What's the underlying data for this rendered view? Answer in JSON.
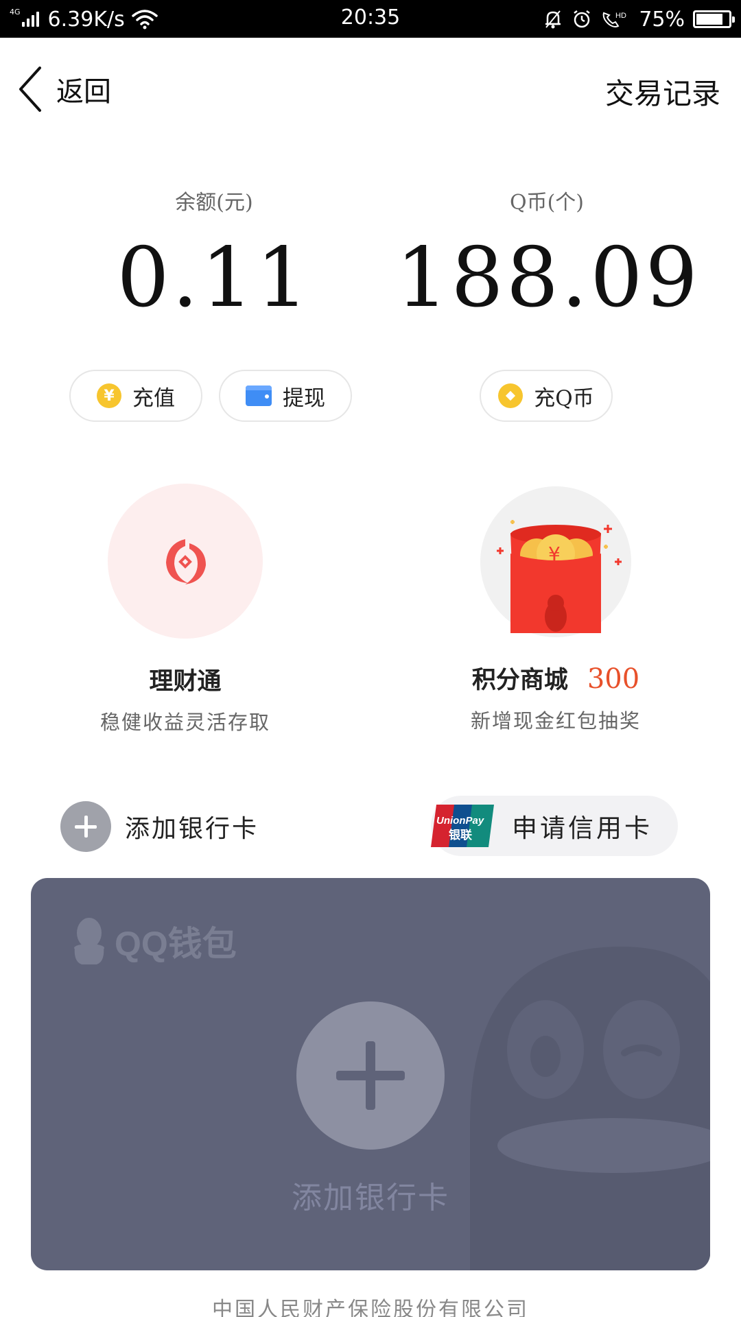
{
  "status_bar": {
    "network": "4G",
    "speed": "6.39K/s",
    "time": "20:35",
    "battery": "75%",
    "battery_level": 0.75
  },
  "nav": {
    "back_label": "返回",
    "history_label": "交易记录"
  },
  "balance": {
    "label": "余额(元)",
    "value": "0.11"
  },
  "qcoin": {
    "label": "Q币(个)",
    "value": "188.09"
  },
  "actions": {
    "recharge_label": "充值",
    "recharge_icon": "¥",
    "withdraw_label": "提现",
    "recharge_qcoin_label": "充Q币"
  },
  "features": {
    "wealth": {
      "title": "理财通",
      "subtitle": "稳健收益灵活存取"
    },
    "points_mall": {
      "title": "积分商城",
      "points": "300",
      "subtitle": "新增现金红包抽奖"
    }
  },
  "card_actions": {
    "add_bank_card_label": "添加银行卡",
    "apply_credit_card_label": "申请信用卡",
    "unionpay_text": "UnionPay",
    "unionpay_cn": "银联"
  },
  "bank_card": {
    "brand": "QQ钱包",
    "add_label": "添加银行卡"
  },
  "footer": {
    "text": "中国人民财产保险股份有限公司"
  },
  "colors": {
    "accent_orange": "#e8512b",
    "coin_yellow": "#f7c52e",
    "card_bg": "#5f6379",
    "wallet_blue": "#3f8df5"
  }
}
